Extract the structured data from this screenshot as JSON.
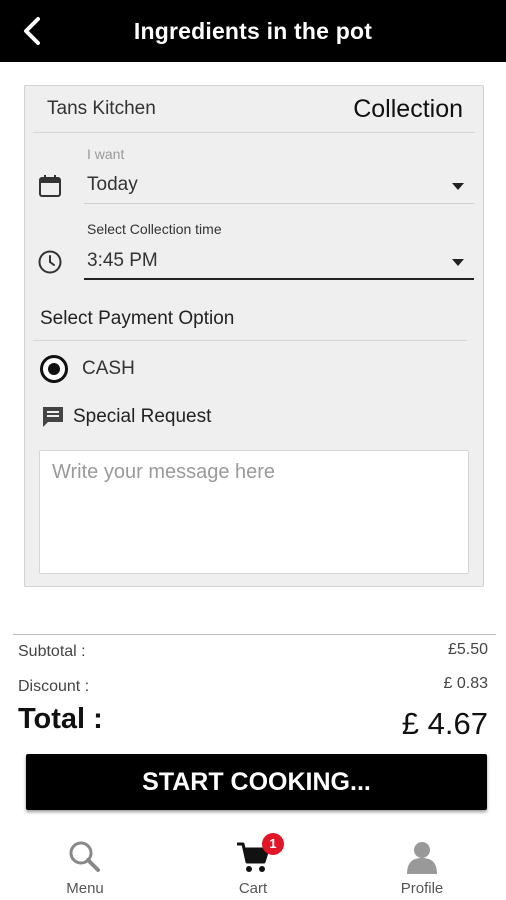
{
  "header": {
    "title": "Ingredients in the pot"
  },
  "order": {
    "restaurant": "Tans Kitchen",
    "mode": "Collection",
    "when_label": "I want",
    "when_value": "Today",
    "time_label": "Select Collection time",
    "time_value": "3:45 PM",
    "payment_title": "Select Payment Option",
    "payment_option": "CASH",
    "special_request_label": "Special Request",
    "message_placeholder": "Write your message here"
  },
  "summary": {
    "subtotal_label": "Subtotal :",
    "subtotal_value": "£5.50",
    "discount_label": "Discount :",
    "discount_value": "£ 0.83",
    "total_label": "Total :",
    "total_value": "£ 4.67"
  },
  "cta": {
    "label": "START COOKING..."
  },
  "nav": {
    "menu": "Menu",
    "cart": "Cart",
    "cart_badge": "1",
    "profile": "Profile"
  },
  "colors": {
    "header": "#000000",
    "badge": "#e01628",
    "card": "#efefef"
  }
}
